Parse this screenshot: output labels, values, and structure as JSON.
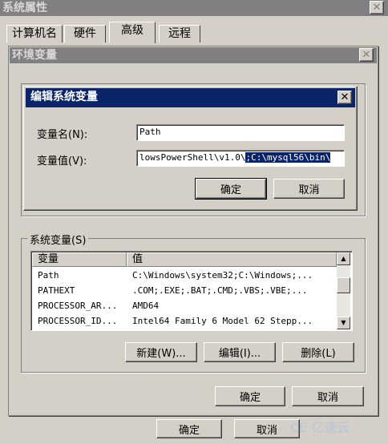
{
  "outer_window": {
    "title": "系统属性",
    "tabs": [
      "计算机名",
      "硬件",
      "高级",
      "远程"
    ],
    "ok_label": "确定",
    "cancel_label": "取消"
  },
  "env_window": {
    "title": "环境变量",
    "ok_label": "确定",
    "cancel_label": "取消",
    "system_group_label": "系统变量(S)",
    "columns": [
      "变量",
      "值"
    ],
    "rows": [
      {
        "name": "Path",
        "value": "C:\\Windows\\system32;C:\\Windows;..."
      },
      {
        "name": "PATHEXT",
        "value": ".COM;.EXE;.BAT;.CMD;.VBS;.VBE;..."
      },
      {
        "name": "PROCESSOR_AR...",
        "value": "AMD64"
      },
      {
        "name": "PROCESSOR_ID...",
        "value": "Intel64 Family 6 Model 62 Stepp..."
      }
    ],
    "new_label": "新建(W)...",
    "edit_label": "编辑(I)...",
    "delete_label": "删除(L)"
  },
  "edit_dialog": {
    "title": "编辑系统变量",
    "name_label": "变量名(N):",
    "name_value": "Path",
    "value_label": "变量值(V):",
    "value_plain": "lowsPowerShell\\v1.0\\",
    "value_selected": ";C:\\mysql56\\bin\\",
    "ok_label": "确定",
    "cancel_label": "取消"
  },
  "watermark": "CE 亿速云",
  "colors": {
    "titlebar_active": "#0a246a",
    "face": "#d4d0c8",
    "titlebar_inactive": "#808080"
  }
}
